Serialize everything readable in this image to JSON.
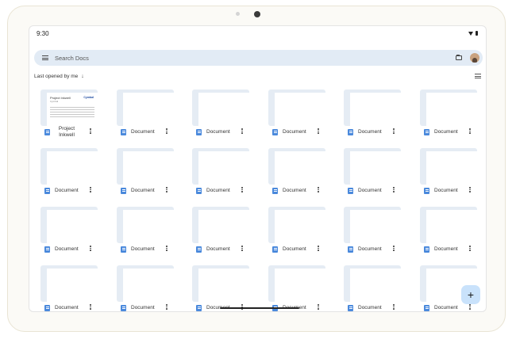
{
  "status": {
    "time": "9:30"
  },
  "search": {
    "placeholder": "Search Docs"
  },
  "sort": {
    "label": "Last opened by me",
    "direction_icon": "arrow-down-icon"
  },
  "documents": [
    {
      "title": "Project Inkwell",
      "preview": {
        "heading": "Project Inkwell",
        "sub": "Cymbal",
        "logo": "Cymbal"
      }
    },
    {
      "title": "Document"
    },
    {
      "title": "Document"
    },
    {
      "title": "Document"
    },
    {
      "title": "Document"
    },
    {
      "title": "Document"
    },
    {
      "title": "Document"
    },
    {
      "title": "Document"
    },
    {
      "title": "Document"
    },
    {
      "title": "Document"
    },
    {
      "title": "Document"
    },
    {
      "title": "Document"
    },
    {
      "title": "Document"
    },
    {
      "title": "Document"
    },
    {
      "title": "Document"
    },
    {
      "title": "Document"
    },
    {
      "title": "Document"
    },
    {
      "title": "Document"
    },
    {
      "title": "Document"
    },
    {
      "title": "Document"
    },
    {
      "title": "Document"
    },
    {
      "title": "Document"
    },
    {
      "title": "Document"
    },
    {
      "title": "Document"
    }
  ],
  "fab": {
    "label": "+"
  },
  "colors": {
    "accent": "#4a89dc",
    "search_bg": "#e2ebf5",
    "fab_bg": "#c9e2fb",
    "thumb_bg": "#e5ecf4"
  }
}
